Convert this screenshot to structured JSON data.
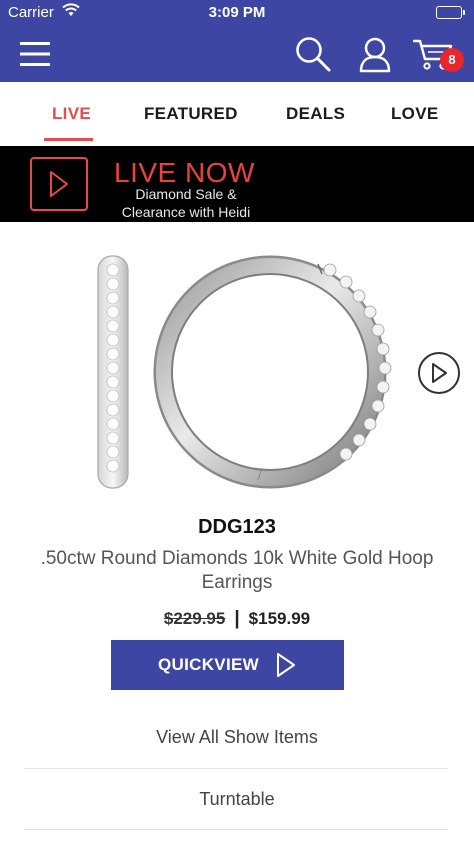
{
  "status_bar": {
    "carrier": "Carrier",
    "time": "3:09 PM"
  },
  "header": {
    "menu_icon": "hamburger-menu-icon",
    "search_icon": "search-icon",
    "account_icon": "user-icon",
    "cart_icon": "cart-icon",
    "cart_count": "8",
    "colors": {
      "brand": "#3d47a3",
      "badge": "#e8262b"
    }
  },
  "tabs": [
    {
      "label": "LIVE",
      "active": true
    },
    {
      "label": "FEATURED"
    },
    {
      "label": "DEALS"
    },
    {
      "label": "LOVE"
    }
  ],
  "live_banner": {
    "title": "LIVE NOW",
    "subtitle": "Diamond Sale & Clearance with Heidi",
    "accent": "#ea4141"
  },
  "product": {
    "sku": "DDG123",
    "name": ".50ctw Round Diamonds 10k White Gold Hoop Earrings",
    "original_price": "$229.95",
    "price_separator": "|",
    "sale_price": "$159.99"
  },
  "quickview": {
    "label": "QUICKVIEW"
  },
  "links": {
    "view_all": "View All Show Items",
    "turntable": "Turntable"
  }
}
